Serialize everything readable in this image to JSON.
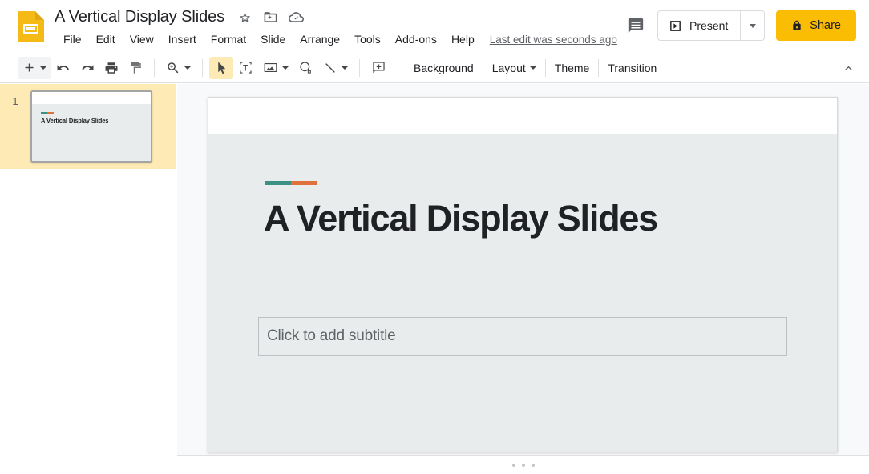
{
  "header": {
    "doc_title": "A Vertical Display Slides",
    "app_icon": "slides-app-icon",
    "title_icons": [
      {
        "name": "star-icon",
        "label": "Star"
      },
      {
        "name": "move-to-folder-icon",
        "label": "Move"
      },
      {
        "name": "cloud-saved-icon",
        "label": "Saved to Drive"
      }
    ],
    "menus": [
      "File",
      "Edit",
      "View",
      "Insert",
      "Format",
      "Slide",
      "Arrange",
      "Tools",
      "Add-ons",
      "Help"
    ],
    "last_edit": "Last edit was seconds ago",
    "comment_label": "Open comment history",
    "present_label": "Present",
    "share_label": "Share",
    "accent_color": "#fbbc04"
  },
  "toolbar": {
    "new_slide_label": "New slide",
    "undo_label": "Undo",
    "redo_label": "Redo",
    "print_label": "Print",
    "paint_format_label": "Paint format",
    "zoom_label": "Zoom",
    "select_label": "Select",
    "textbox_label": "Text box",
    "image_label": "Insert image",
    "shape_label": "Shape",
    "line_label": "Line",
    "comment_label": "Add comment",
    "background_label": "Background",
    "layout_label": "Layout",
    "theme_label": "Theme",
    "transition_label": "Transition",
    "collapse_label": "Hide the menus"
  },
  "filmstrip": {
    "slides": [
      {
        "number": "1",
        "title": "A Vertical Display Slides",
        "selected": true
      }
    ]
  },
  "slide": {
    "title": "A Vertical Display Slides",
    "subtitle_placeholder": "Click to add subtitle",
    "accent_left_color": "#3a9285",
    "accent_right_color": "#e2703a",
    "background_color": "#e8ecec",
    "header_band_color": "#ffffff"
  },
  "notes": {
    "handle_label": "Drag to resize speaker notes"
  }
}
